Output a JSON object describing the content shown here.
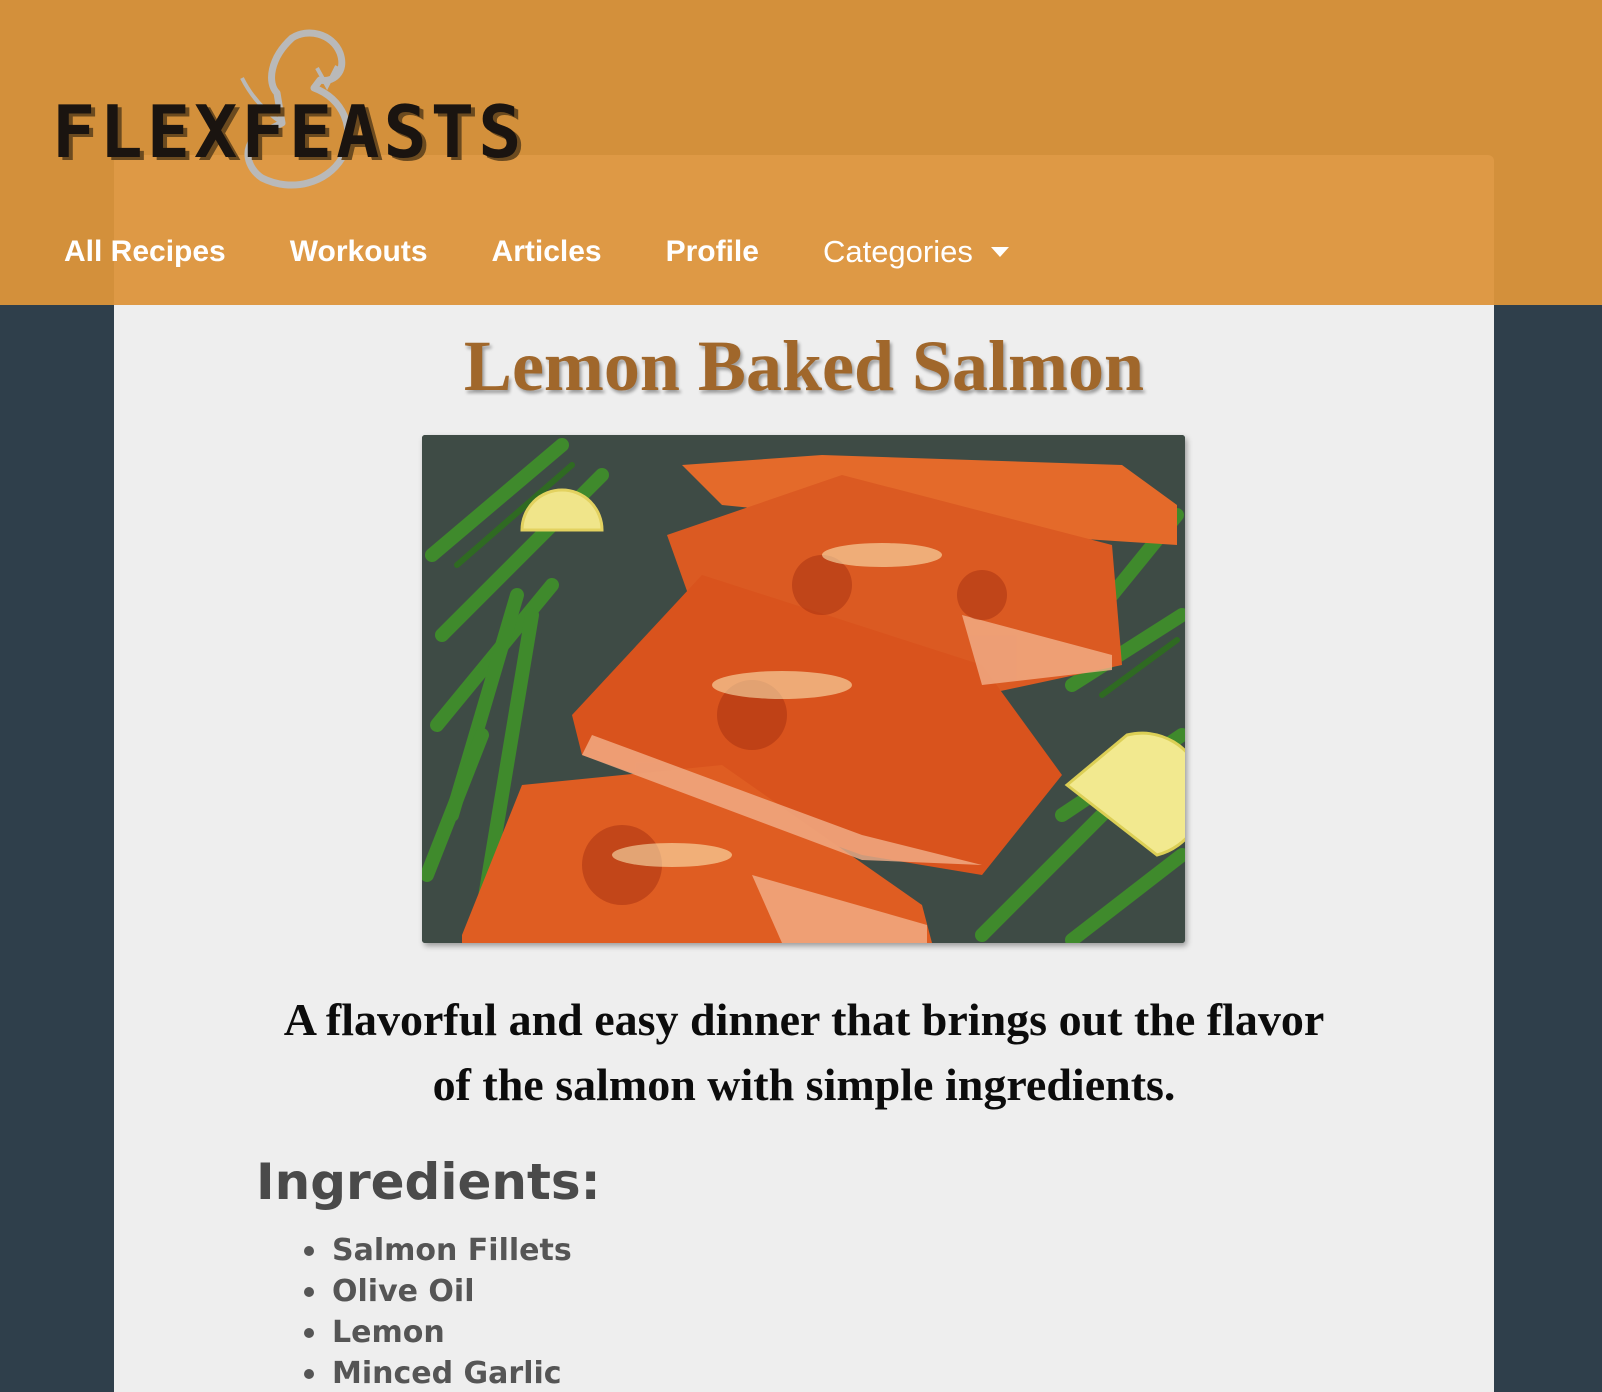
{
  "header": {
    "logo_text": "FLEXFEASTS",
    "nav": [
      {
        "label": "All Recipes"
      },
      {
        "label": "Workouts"
      },
      {
        "label": "Articles"
      },
      {
        "label": "Profile"
      }
    ],
    "categories_label": "Categories"
  },
  "recipe": {
    "title": "Lemon Baked Salmon",
    "image_icon": "salmon-photo",
    "description": "A flavorful and easy dinner that brings out the flavor of the salmon with simple ingredients.",
    "ingredients_title": "Ingredients:",
    "ingredients": [
      "Salmon Fillets",
      "Olive Oil",
      "Lemon",
      "Minced Garlic"
    ]
  },
  "colors": {
    "header": "#d3903b",
    "nav_panel": "#de9945",
    "background": "#2f3f4b",
    "content_bg": "#eeeeee",
    "title": "#a0672b"
  }
}
